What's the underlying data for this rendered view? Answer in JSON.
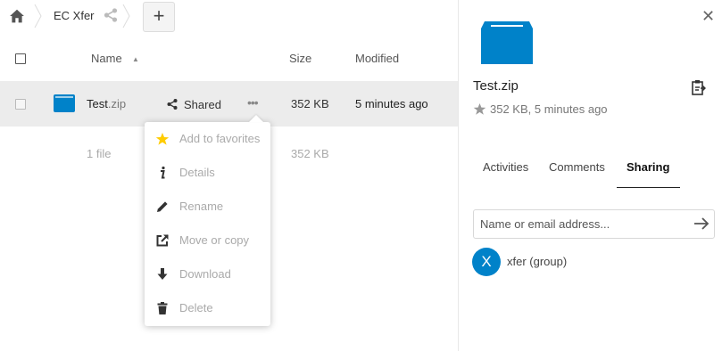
{
  "breadcrumb": {
    "folder": "EC Xfer",
    "add_label": "+"
  },
  "columns": {
    "name": "Name",
    "size": "Size",
    "modified": "Modified"
  },
  "file": {
    "name_base": "Test",
    "name_ext": ".zip",
    "shared_label": "Shared",
    "actions_label": "•••",
    "size": "352 KB",
    "modified": "5 minutes ago"
  },
  "summary": {
    "count": "1 file",
    "size": "352 KB"
  },
  "menu": {
    "items": [
      {
        "label": "Add to favorites",
        "icon": "star-icon"
      },
      {
        "label": "Details",
        "icon": "info-icon"
      },
      {
        "label": "Rename",
        "icon": "pencil-icon"
      },
      {
        "label": "Move or copy",
        "icon": "external-link-icon"
      },
      {
        "label": "Download",
        "icon": "download-icon"
      },
      {
        "label": "Delete",
        "icon": "trash-icon"
      }
    ]
  },
  "sidebar": {
    "close": "✕",
    "file_name": "Test.zip",
    "meta": "352 KB, 5 minutes ago",
    "tabs": [
      {
        "label": "Activities"
      },
      {
        "label": "Comments"
      },
      {
        "label": "Sharing"
      }
    ],
    "share_placeholder": "Name or email address...",
    "share": {
      "avatar_letter": "X",
      "name": "xfer (group)"
    }
  },
  "colors": {
    "brand_blue": "#0082c9",
    "star_yellow": "#fc0",
    "row_highlight": "#ececec"
  }
}
